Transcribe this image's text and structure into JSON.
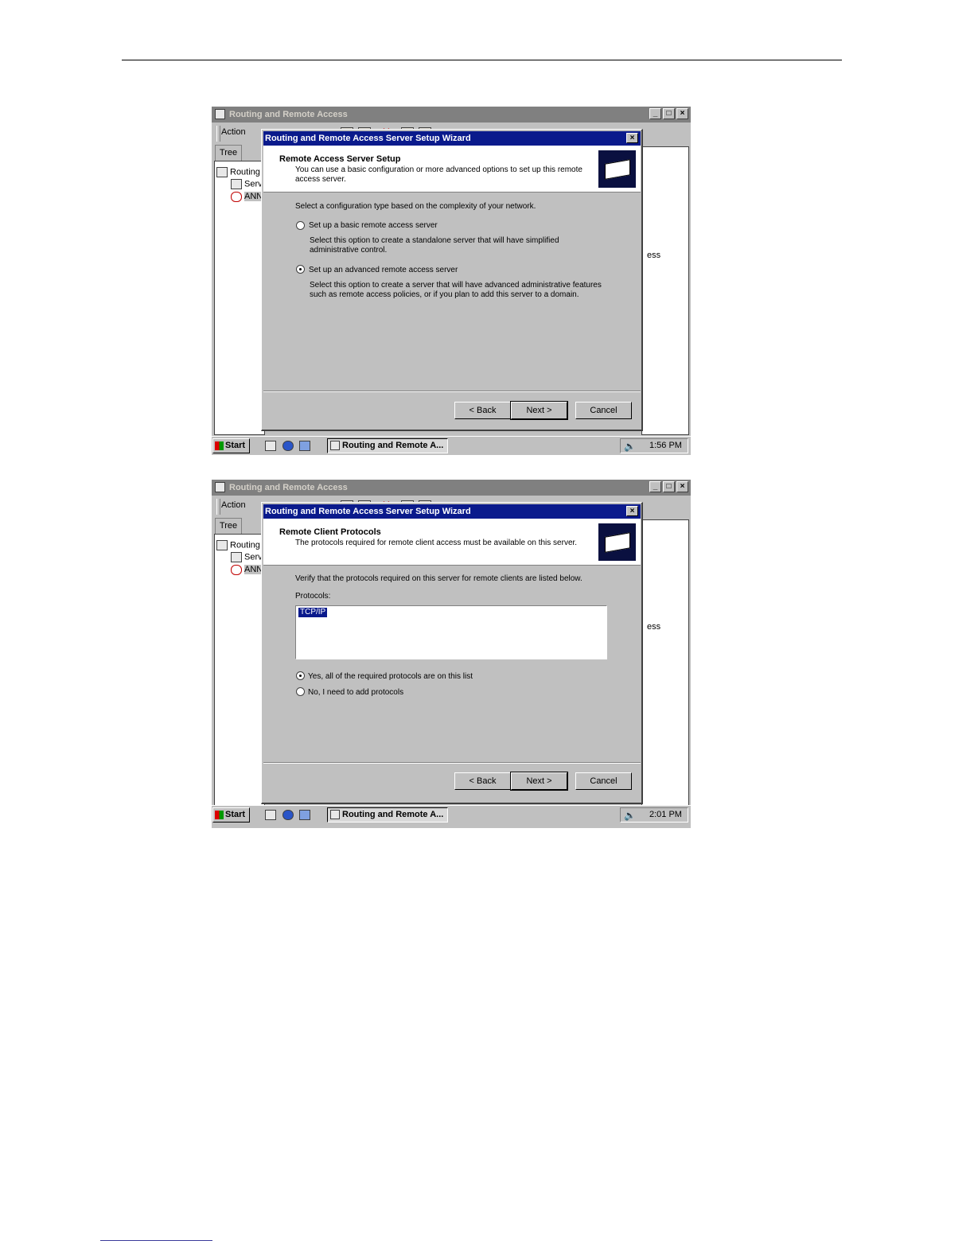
{
  "screens": [
    {
      "app_title": "Routing and Remote Access",
      "menu_action": "Action",
      "tree_tab": "Tree",
      "tree_items": [
        "Routing",
        "Serv",
        "ANN"
      ],
      "right_pane_text": "ess",
      "dialog_title": "Routing and Remote Access Server Setup Wizard",
      "header_title": "Remote Access Server Setup",
      "header_subtitle": "You can use a basic configuration or more advanced options to set up this remote access server.",
      "instruction": "Select a configuration type based on the complexity of your network.",
      "options": [
        {
          "label": "Set up a basic remote access server",
          "description_1": "Select this option to create a standalone server that will have simplified",
          "description_2": "administrative control.",
          "selected": false
        },
        {
          "label": "Set up an advanced remote access server",
          "description_1": "Select this option to create a server that will have advanced administrative features",
          "description_2": "such as remote access policies, or if you plan to add this server to a domain.",
          "selected": true
        }
      ],
      "buttons": {
        "back": "< Back",
        "next": "Next >",
        "cancel": "Cancel"
      },
      "taskbar": {
        "start": "Start",
        "task": "Routing and Remote A...",
        "clock": "1:56 PM"
      }
    },
    {
      "app_title": "Routing and Remote Access",
      "menu_action": "Action",
      "tree_tab": "Tree",
      "tree_items": [
        "Routing",
        "Serv",
        "ANN"
      ],
      "right_pane_text": "ess",
      "dialog_title": "Routing and Remote Access Server Setup Wizard",
      "header_title": "Remote Client Protocols",
      "header_subtitle": "The protocols required for remote client access must be available on this server.",
      "instruction": "Verify that the protocols required on this server for remote clients are listed below.",
      "protocols_label": "Protocols:",
      "protocols": [
        "TCP/IP"
      ],
      "options": [
        {
          "label": "Yes, all of the required protocols are on this list",
          "selected": true
        },
        {
          "label": "No, I need to add protocols",
          "selected": false
        }
      ],
      "buttons": {
        "back": "< Back",
        "next": "Next >",
        "cancel": "Cancel"
      },
      "taskbar": {
        "start": "Start",
        "task": "Routing and Remote A...",
        "clock": "2:01 PM"
      }
    }
  ]
}
